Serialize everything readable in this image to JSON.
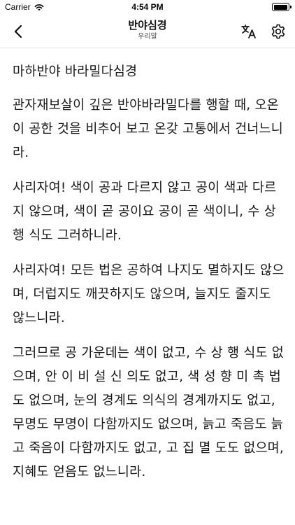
{
  "status_bar": {
    "carrier": "Carrier",
    "time": "4:54 PM",
    "battery_level": 0.95
  },
  "nav": {
    "title": "반야심경",
    "subtitle": "우리말",
    "back_icon": "chevron-left-icon",
    "translate_icon": "translate-icon",
    "settings_icon": "gear-icon"
  },
  "content": {
    "paragraphs": [
      "마하반야 바라밀다심경",
      "관자재보살이 깊은 반야바라밀다를 행할 때, 오온이 공한 것을 비추어 보고 온갖 고통에서 건너느니라.",
      "사리자여! 색이 공과 다르지 않고 공이 색과 다르지 않으며, 색이 곧 공이요 공이 곧 색이니, 수 상 행 식도 그러하니라.",
      "사리자여! 모든 법은 공하여 나지도 멸하지도 않으며, 더럽지도 깨끗하지도 않으며, 늘지도 줄지도 않느니라.",
      "그러므로 공 가운데는 색이 없고, 수 상 행 식도 없으며, 안 이 비 설 신 의도 없고, 색 성 향 미 촉 법도 없으며, 눈의 경계도 의식의 경계까지도 없고, 무명도 무명이 다함까지도 없으며, 늙고 죽음도 늙고 죽음이 다함까지도 없고, 고 집 멸 도도 없으며, 지혜도 얻음도 없느니라."
    ]
  }
}
